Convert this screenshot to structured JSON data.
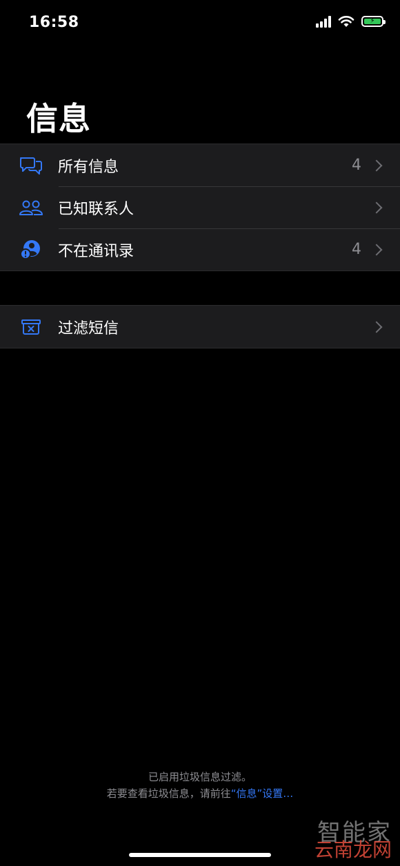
{
  "status_bar": {
    "time": "16:58",
    "icons": [
      "cellular-signal-icon",
      "wifi-icon",
      "battery-charging-icon"
    ],
    "battery_color": "#34c759"
  },
  "title": "信息",
  "groups": [
    {
      "items": [
        {
          "label": "所有信息",
          "count": "4",
          "icon": "messages-bubbles-icon"
        },
        {
          "label": "已知联系人",
          "count": "",
          "icon": "contacts-people-icon"
        },
        {
          "label": "不在通讯录",
          "count": "4",
          "icon": "unknown-sender-icon"
        }
      ]
    },
    {
      "items": [
        {
          "label": "过滤短信",
          "count": "",
          "icon": "filtered-box-icon"
        }
      ]
    }
  ],
  "footer": {
    "line1": "已启用垃圾信息过滤。",
    "line2_prefix": "若要查看垃圾信息，请前往",
    "line2_link": "“信息”设置…"
  },
  "watermark": {
    "top": "智能家",
    "bottom": "云南龙网"
  },
  "colors": {
    "accent": "#3478f6",
    "background": "#000000",
    "cell": "#1c1c1e",
    "secondary_text": "#8e8e93"
  }
}
